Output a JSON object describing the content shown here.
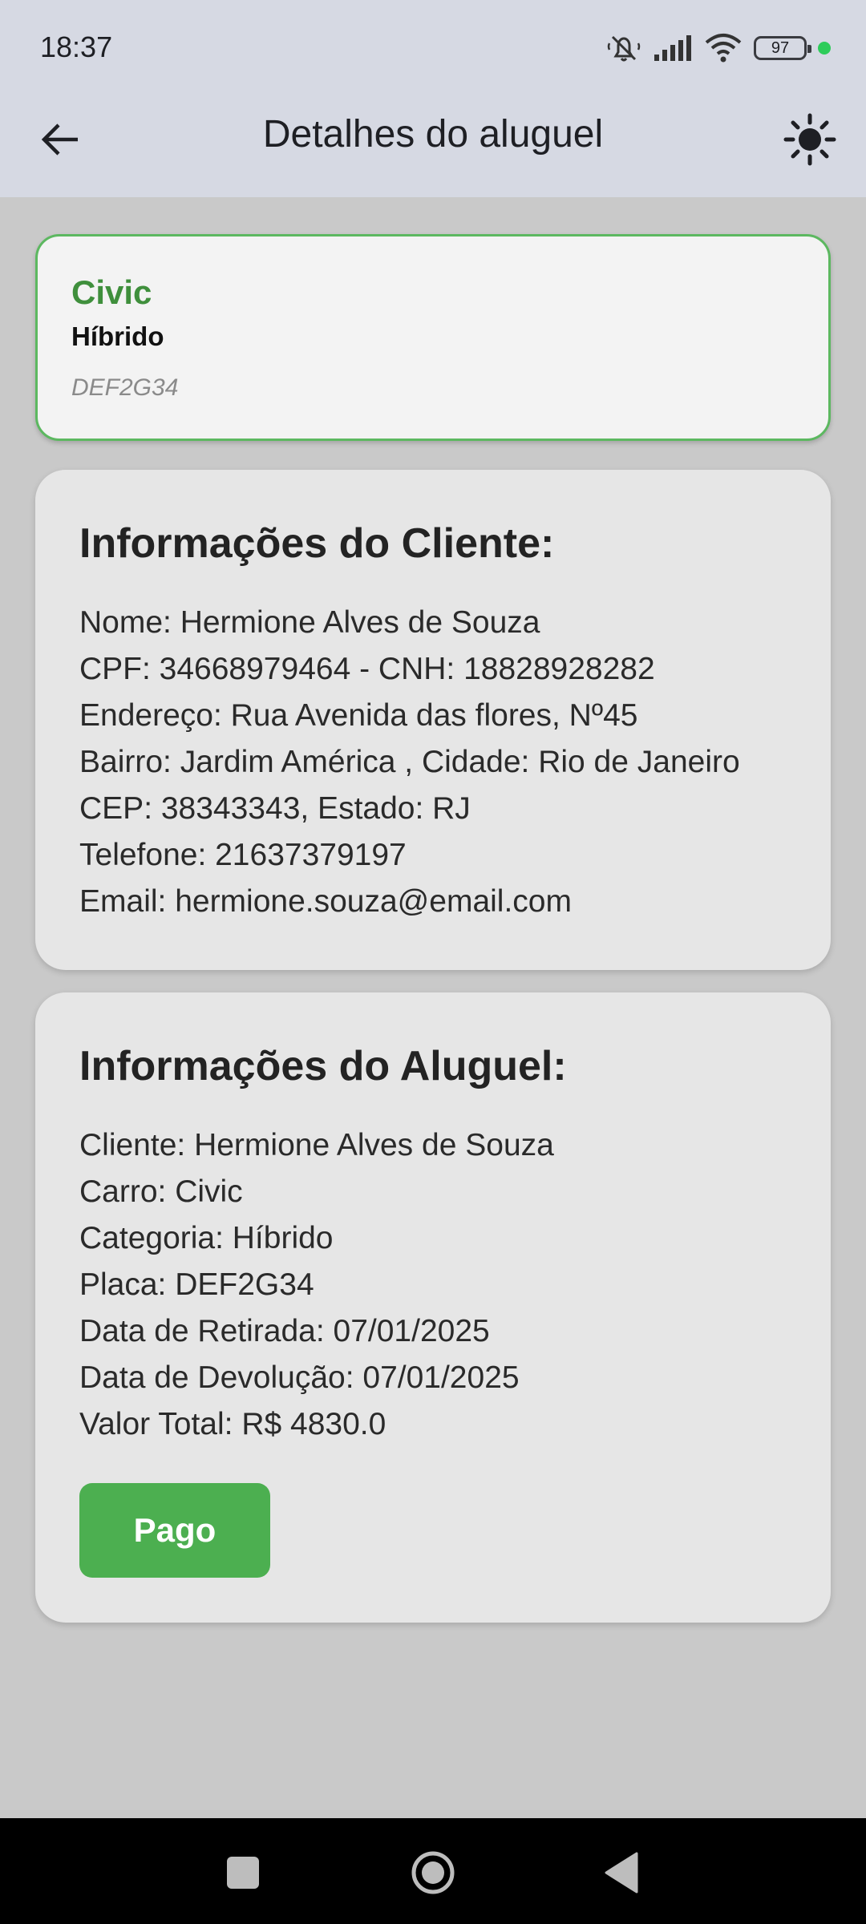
{
  "status_bar": {
    "time": "18:37",
    "battery": "97",
    "icons": [
      "mute-icon",
      "signal-icon",
      "wifi-icon",
      "battery-icon"
    ]
  },
  "app_bar": {
    "title": "Detalhes do aluguel",
    "icons": [
      "arrow-back-icon",
      "brightness-icon"
    ]
  },
  "car": {
    "model": "Civic",
    "category": "Híbrido",
    "plate": "DEF2G34"
  },
  "client_info": {
    "heading": "Informações do Cliente:",
    "lines": [
      "Nome: Hermione Alves de Souza",
      "CPF: 34668979464 - CNH: 18828928282",
      "Endereço: Rua Avenida das flores, Nº45",
      "Bairro: Jardim América , Cidade: Rio de Janeiro",
      "CEP: 38343343, Estado: RJ",
      "Telefone: 21637379197",
      "Email: hermione.souza@email.com"
    ]
  },
  "rental_info": {
    "heading": "Informações do Aluguel:",
    "lines": [
      "Cliente: Hermione Alves de Souza",
      "Carro: Civic",
      "Categoria: Híbrido",
      "Placa: DEF2G34",
      "Data de Retirada: 07/01/2025",
      "Data de Devolução: 07/01/2025",
      "Valor Total: R$ 4830.0"
    ],
    "status_button": "Pago"
  },
  "colors": {
    "accent": "#4caf50",
    "model_text": "#3f8f3c",
    "app_bar_bg": "#d6d9e3",
    "screen_bg": "#c9c9c9"
  }
}
